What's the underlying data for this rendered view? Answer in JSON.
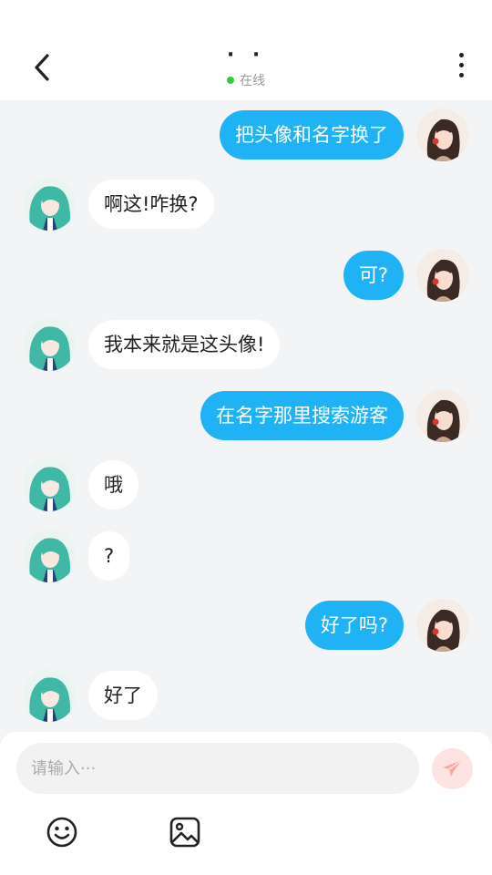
{
  "header": {
    "title": "· ·",
    "status_text": "在线"
  },
  "messages": [
    {
      "side": "right",
      "text": "把头像和名字换了"
    },
    {
      "side": "left",
      "text": "啊这!咋换?"
    },
    {
      "side": "right",
      "text": "可?"
    },
    {
      "side": "left",
      "text": "我本来就是这头像!"
    },
    {
      "side": "right",
      "text": "在名字那里搜索游客"
    },
    {
      "side": "left",
      "text": "哦"
    },
    {
      "side": "left",
      "text": "?"
    },
    {
      "side": "right",
      "text": "好了吗?"
    },
    {
      "side": "left",
      "text": "好了"
    }
  ],
  "composer": {
    "placeholder": "请输入···",
    "value": ""
  },
  "icons": {
    "back": "chevron-left-icon",
    "more": "more-vertical-icon",
    "send": "paper-plane-icon",
    "emoji": "smiley-icon",
    "image": "image-icon"
  },
  "colors": {
    "outgoing_bubble": "#1fb3f5",
    "incoming_bubble": "#ffffff",
    "online_dot": "#2ecc40",
    "send_button_bg": "#fde4e2",
    "send_button_icon": "#f5a99f",
    "background": "#f3f4f6"
  }
}
